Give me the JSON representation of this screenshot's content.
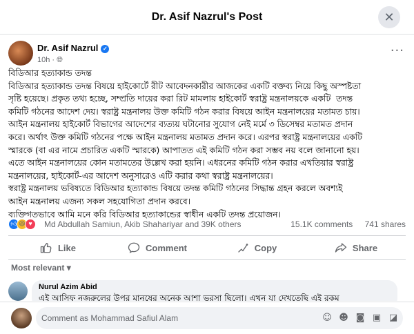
{
  "header": {
    "title": "Dr. Asif Nazrul's Post",
    "close_glyph": "✕"
  },
  "post": {
    "author": "Dr. Asif Nazrul",
    "time": "10h · ",
    "more_glyph": "···",
    "body": "বিডিআর হত্যাকান্ড তদন্ত\nবিডিআর হত্যাকান্ড তদন্ত বিষয়ে হাইকোর্টে রীট আবেদনকারীর আজকের একটি বক্তব্য নিয়ে কিছু অস্পষ্টতা\nসৃষ্টি হয়েছে। প্রকৃত তথ্য হচ্ছে, সম্প্রতি দায়ের করা রিট মামলায় হাইকোর্ট স্বরাষ্ট্র মন্ত্রনালয়কে একটি  তদন্ত\nকমিটি গঠনের আদেশ দেয়। স্বরাষ্ট্র মন্ত্রনালয় উক্ত কমিটি গঠন করার বিষয়ে আইন মন্ত্রনালয়ের মতামত চায়।\nআইন মন্ত্রনালয় হাইকোর্ট বিভাগের আদেশের ব্যত্যয় ঘটানোর সুযোগ নেই মর্মে ৩ ডিসেম্বর মতামত প্রদান\nকরে। অর্থাৎ উক্ত কমিটি গঠনের পক্ষে আইন মন্ত্রনালয় মতামত প্রদান করে। এরপর স্বরাষ্ট্র মন্ত্রনালয়ের একটি\nস্মারকে (বা এর নামে প্রচারিত একটি স্মারকে) আপাতত এই কমিটি গঠন করা সম্ভব নয় বলে জানানো হয়।\nএতে আইন মন্ত্রনালয়ের কোন মতামতের উল্লেখ করা হয়নি। এধরনের কমিটি গঠন করার এখতিয়ার স্বরাষ্ট্র\nমন্ত্রনালয়ের, হাইকোর্ট-এর আদেশ অনুসারেও এটি করার কথা স্বরাষ্ট্র মন্ত্রনালয়ের।\nস্বরাষ্ট্র মন্ত্রনালয় ভবিষ্যতে বিডিআর হত্যাকান্ড বিষয়ে তদন্ত কমিটি গঠনের সিদ্ধান্ত গ্রহন করলে অবশ্যই\nআইন মন্ত্রনালয় এজন্য সকল সহযোগিতা প্রদান করবে।\nব্যক্তিগতভাবে আমি মনে করি বিডিআর হত্যাকান্ডের স্বাধীন একটি তদন্ত প্রয়োজন।"
  },
  "reactions": {
    "names": "Md Abdullah Samiun, Akib Shahariyar and 39K others",
    "comments": "15.1K comments",
    "shares": "741 shares"
  },
  "actions": {
    "like": "Like",
    "comment": "Comment",
    "copy": "Copy",
    "share": "Share"
  },
  "sort": {
    "label": "Most relevant ▾"
  },
  "comment": {
    "name": "Nurul Azim Abid",
    "text": "এই আসিফ নজরুলের উপর মানুষের অনেক আশা ভরসা ছিলো। এখন যা দেখতেছি এই রকম"
  },
  "composer": {
    "placeholder": "Comment as Mohammad Safiul Alam"
  }
}
